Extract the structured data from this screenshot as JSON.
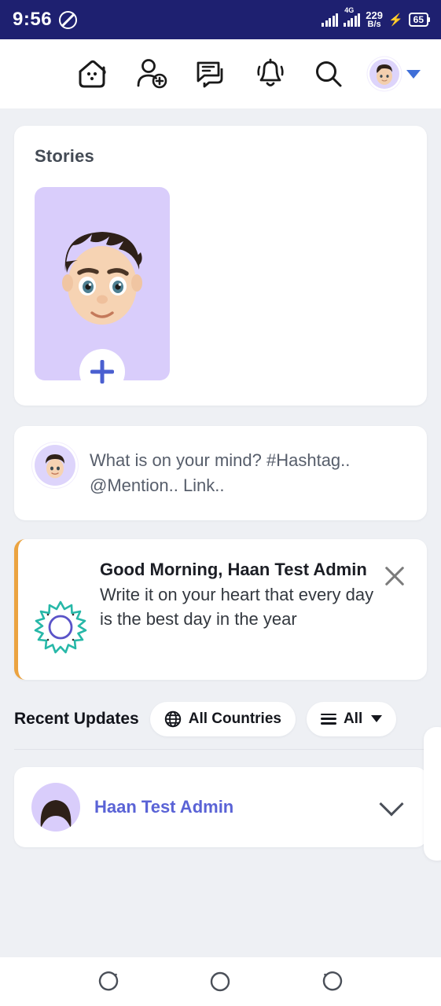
{
  "statusbar": {
    "time": "9:56",
    "dnd_icon": "do-not-disturb-icon",
    "network_type": "4G",
    "data_speed_value": "229",
    "data_speed_unit": "B/s",
    "charging_icon": "⚡",
    "battery_level": "65"
  },
  "header": {
    "menu_icon": "hamburger-menu-icon",
    "home_icon": "home-icon",
    "add_friend_icon": "add-person-icon",
    "messages_icon": "chat-bubble-icon",
    "notifications_icon": "bell-icon",
    "search_icon": "search-icon",
    "profile_icon": "avatar",
    "dropdown_icon": "caret-down-icon"
  },
  "stories": {
    "title": "Stories",
    "add_story_icon": "plus-icon"
  },
  "composer": {
    "placeholder": "What is on your mind? #Hashtag.. @Mention.. Link.."
  },
  "greeting": {
    "icon": "sun-icon",
    "title": "Good Morning, Haan Test Admin",
    "message": "Write it on your heart that every day is the best day in the year",
    "close_icon": "close-icon",
    "accent_color": "#eba340"
  },
  "updates": {
    "title": "Recent Updates",
    "country_filter": {
      "icon": "globe-icon",
      "label": "All Countries"
    },
    "type_filter": {
      "icon": "lines-icon",
      "label": "All",
      "caret": "caret-down-icon"
    }
  },
  "post": {
    "author": "Haan Test Admin",
    "expand_icon": "chevron-down-icon"
  },
  "navbar": {
    "recents_icon": "recent-apps-icon",
    "home_icon": "home-circle-icon",
    "back_icon": "back-icon"
  },
  "colors": {
    "statusbar_bg": "#1e2070",
    "page_bg": "#eef0f4",
    "accent_purple": "#5a63d6",
    "story_bg": "#d9cdfb",
    "greeting_accent": "#eba340"
  }
}
